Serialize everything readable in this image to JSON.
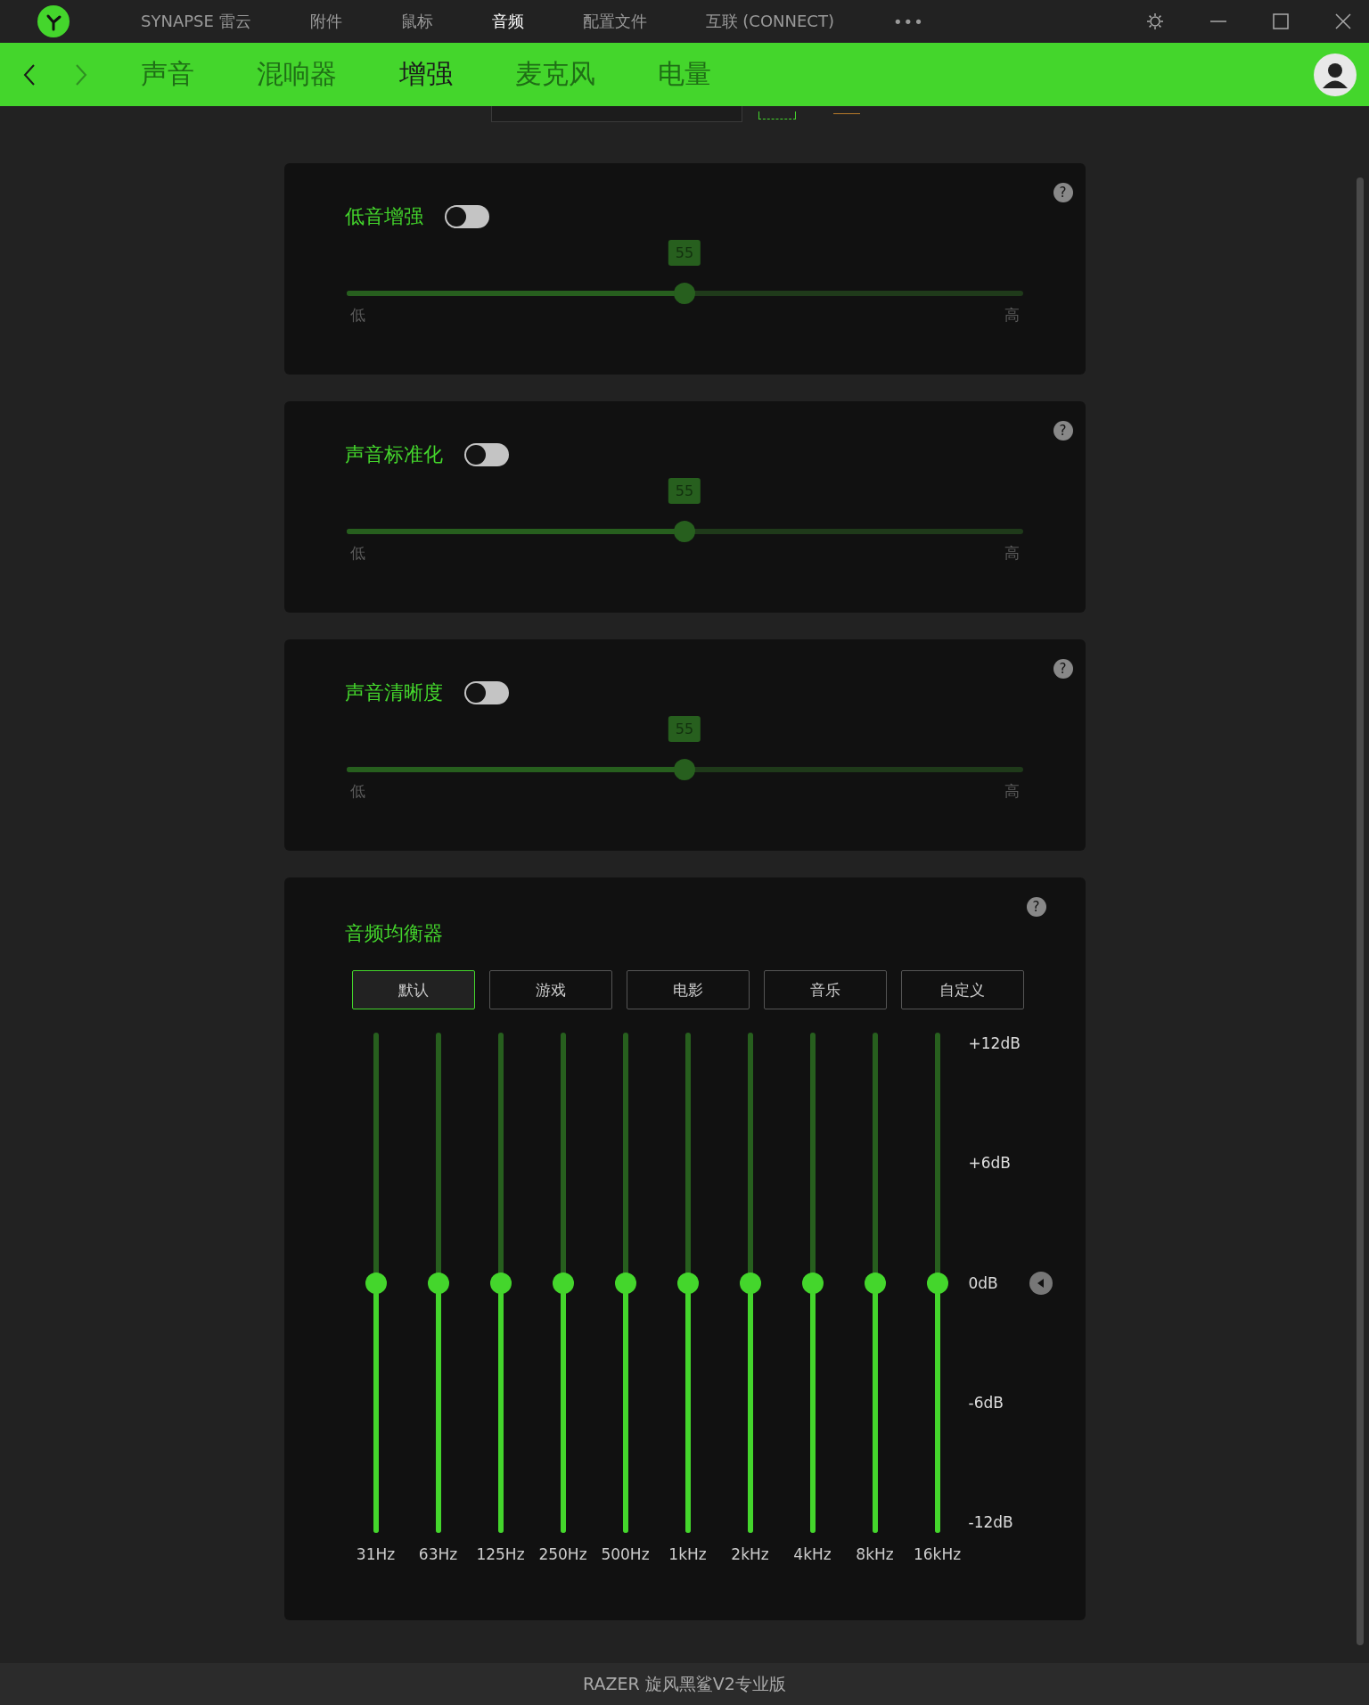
{
  "title_bar": {
    "items": [
      {
        "label": "SYNAPSE 雷云",
        "selected": false
      },
      {
        "label": "附件",
        "selected": false
      },
      {
        "label": "鼠标",
        "selected": false
      },
      {
        "label": "音频",
        "selected": true
      },
      {
        "label": "配置文件",
        "selected": false
      },
      {
        "label": "互联 (CONNECT)",
        "selected": false
      }
    ],
    "more": "•••"
  },
  "nav": {
    "tabs": [
      {
        "label": "声音",
        "selected": false
      },
      {
        "label": "混响器",
        "selected": false
      },
      {
        "label": "增强",
        "selected": true
      },
      {
        "label": "麦克风",
        "selected": false
      },
      {
        "label": "电量",
        "selected": false
      }
    ]
  },
  "cards": [
    {
      "title": "低音增强",
      "on": false,
      "value": "55",
      "level": 0.5,
      "low": "低",
      "high": "高",
      "help": "?"
    },
    {
      "title": "声音标准化",
      "on": false,
      "value": "55",
      "level": 0.5,
      "low": "低",
      "high": "高",
      "help": "?"
    },
    {
      "title": "声音清晰度",
      "on": false,
      "value": "55",
      "level": 0.5,
      "low": "低",
      "high": "高",
      "help": "?"
    }
  ],
  "equalizer": {
    "title": "音频均衡器",
    "help": "?",
    "presets": [
      {
        "label": "默认",
        "selected": true
      },
      {
        "label": "游戏",
        "selected": false
      },
      {
        "label": "电影",
        "selected": false
      },
      {
        "label": "音乐",
        "selected": false
      },
      {
        "label": "自定义",
        "selected": false
      }
    ],
    "scale": [
      "+12dB",
      "+6dB",
      "0dB",
      "-6dB",
      "-12dB"
    ],
    "bands": [
      {
        "label": "31Hz",
        "level": 0.5
      },
      {
        "label": "63Hz",
        "level": 0.5
      },
      {
        "label": "125Hz",
        "level": 0.5
      },
      {
        "label": "250Hz",
        "level": 0.5
      },
      {
        "label": "500Hz",
        "level": 0.5
      },
      {
        "label": "1kHz",
        "level": 0.5
      },
      {
        "label": "2kHz",
        "level": 0.5
      },
      {
        "label": "4kHz",
        "level": 0.5
      },
      {
        "label": "8kHz",
        "level": 0.5
      },
      {
        "label": "16kHz",
        "level": 0.5
      }
    ]
  },
  "footer": "RAZER 旋风黑鲨V2专业版"
}
